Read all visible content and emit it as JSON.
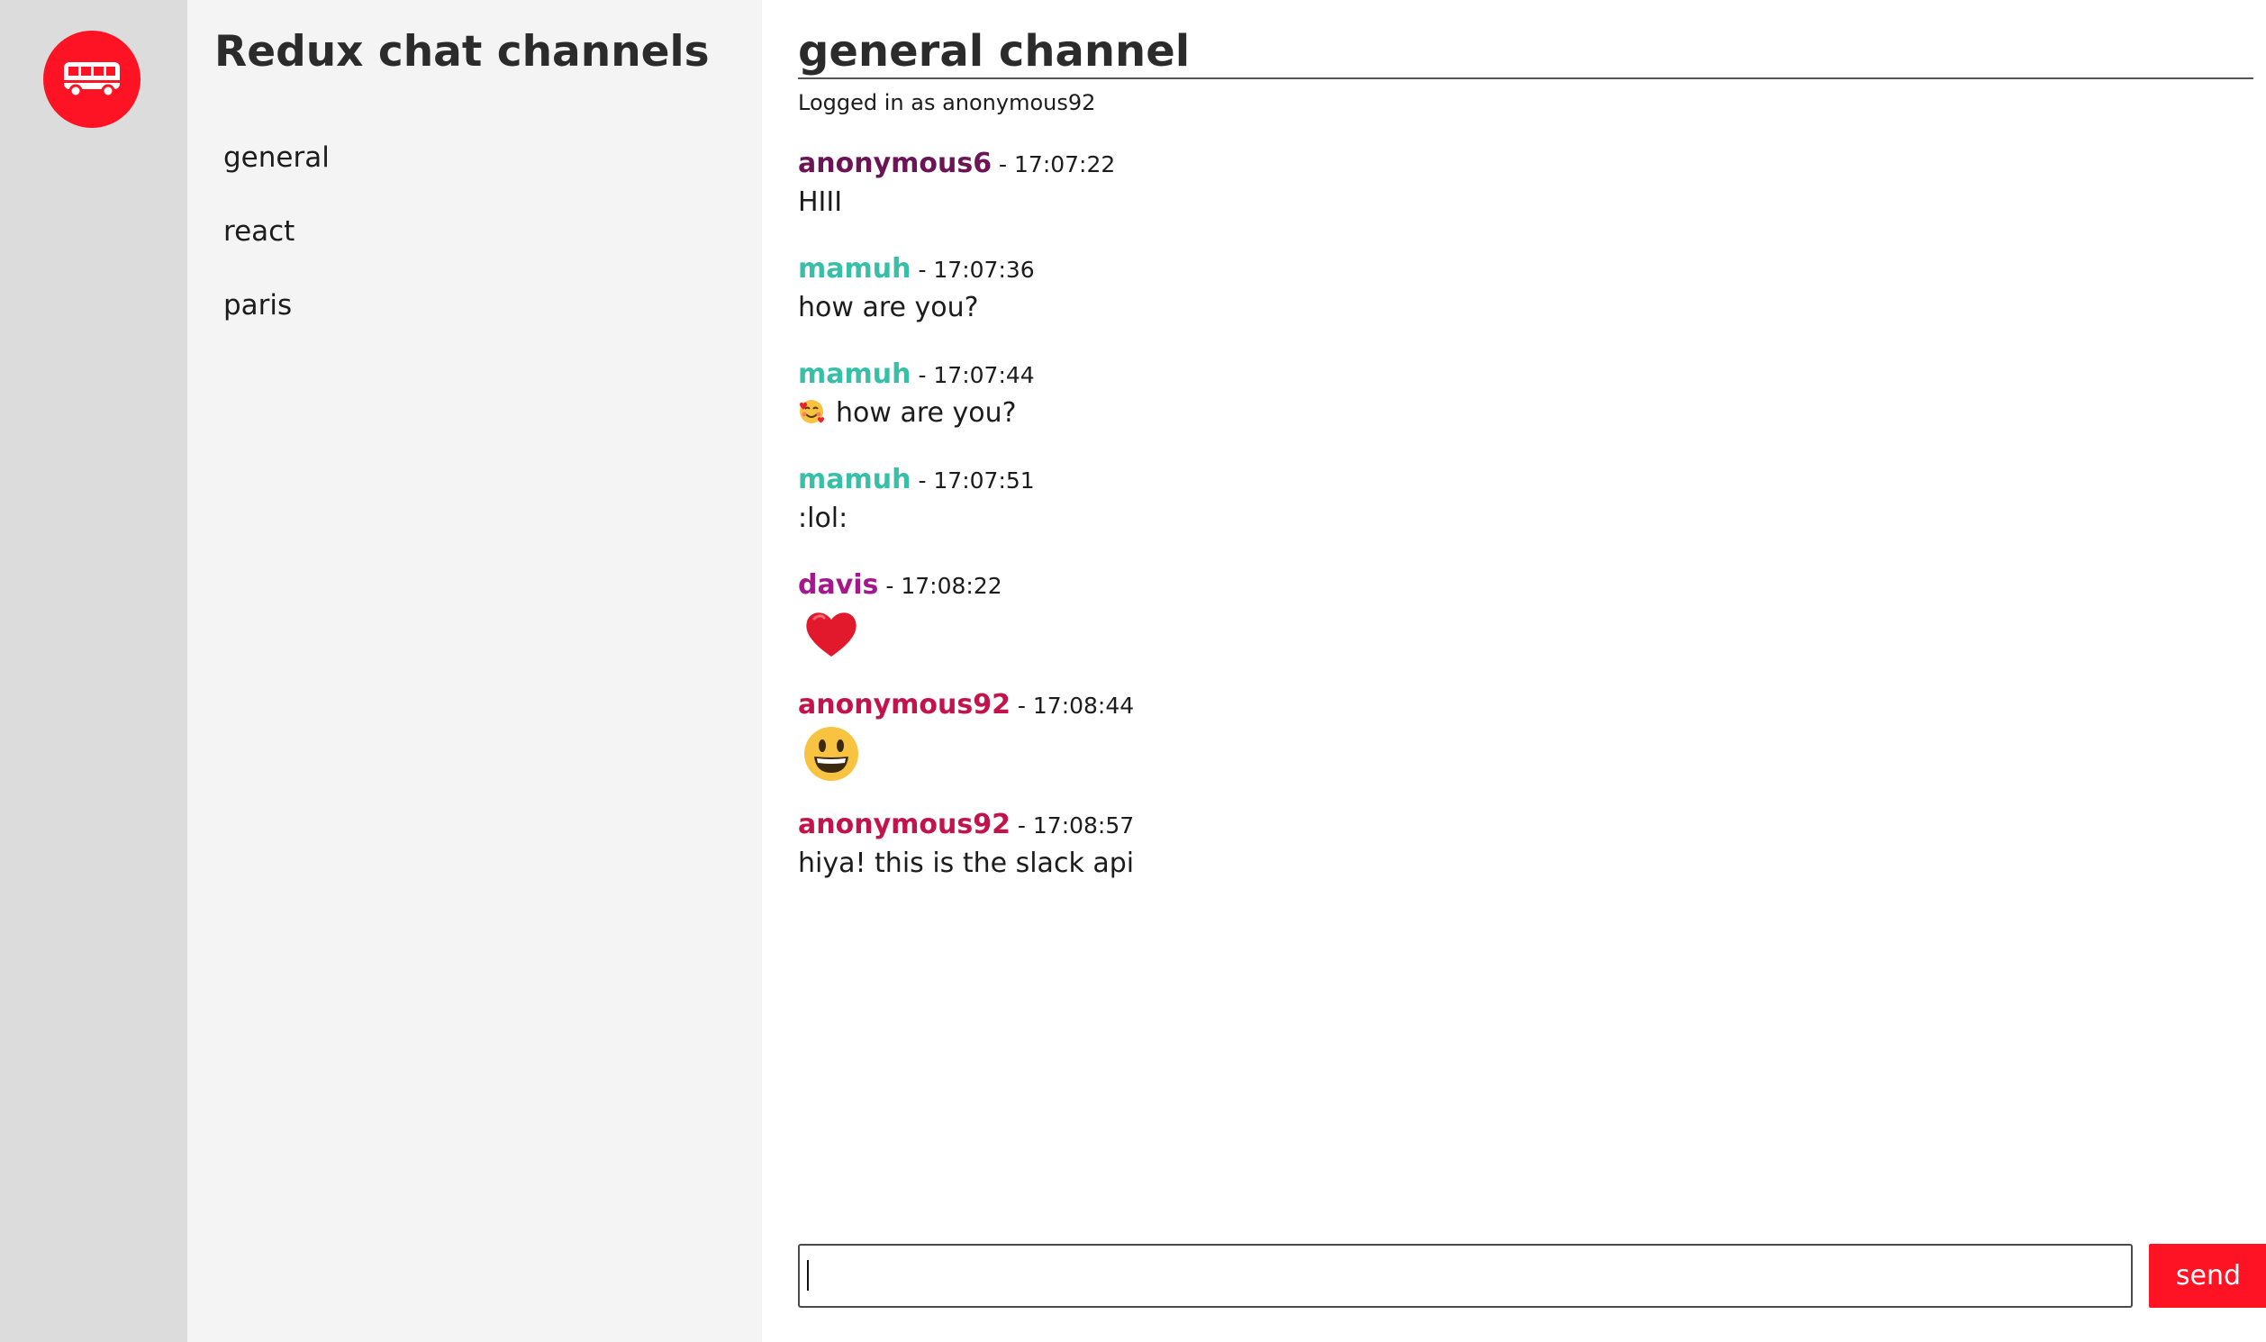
{
  "app": {
    "logo_icon": "bus-icon",
    "brand_color": "#fd1324"
  },
  "sidebar": {
    "title": "Redux chat channels",
    "channels": [
      {
        "label": "general"
      },
      {
        "label": "react"
      },
      {
        "label": "paris"
      }
    ]
  },
  "channel": {
    "title": "general channel",
    "logged_in": "Logged in as anonymous92"
  },
  "messages": [
    {
      "author": "anonymous6",
      "author_color": "#6b1456",
      "time": "17:07:22",
      "text": "HIII",
      "emoji": ""
    },
    {
      "author": "mamuh",
      "author_color": "#38bfa7",
      "time": "17:07:36",
      "text": "how are you?",
      "emoji": ""
    },
    {
      "author": "mamuh",
      "author_color": "#38bfa7",
      "time": "17:07:44",
      "text": "how are you?",
      "emoji": "smiling-face-with-hearts-icon"
    },
    {
      "author": "mamuh",
      "author_color": "#38bfa7",
      "time": "17:07:51",
      "text": ":lol:",
      "emoji": ""
    },
    {
      "author": "davis",
      "author_color": "#a3188c",
      "time": "17:08:22",
      "text": "",
      "emoji": "red-heart-icon"
    },
    {
      "author": "anonymous92",
      "author_color": "#c2144a",
      "time": "17:08:44",
      "text": "",
      "emoji": "grinning-face-icon"
    },
    {
      "author": "anonymous92",
      "author_color": "#c2144a",
      "time": "17:08:57",
      "text": "hiya! this is the slack api",
      "emoji": ""
    }
  ],
  "composer": {
    "value": "",
    "send_label": "send"
  }
}
